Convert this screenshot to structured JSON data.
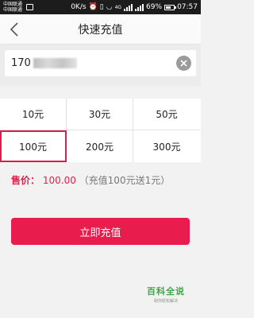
{
  "status_bar": {
    "carrier_1": "中国联通",
    "carrier_2": "中国联通",
    "speed": "0K/s",
    "network": "4G",
    "battery": "69%",
    "battery_level": 0.69,
    "time": "07:57"
  },
  "nav": {
    "title": "快速充值"
  },
  "phone": {
    "value": "170"
  },
  "amounts": [
    {
      "label": "10元",
      "selected": false
    },
    {
      "label": "30元",
      "selected": false
    },
    {
      "label": "50元",
      "selected": false
    },
    {
      "label": "100元",
      "selected": true
    },
    {
      "label": "200元",
      "selected": false
    },
    {
      "label": "300元",
      "selected": false
    }
  ],
  "price": {
    "label": "售价：",
    "value": "100.00",
    "note": "（充值100元送1元）"
  },
  "recharge_button": {
    "label": "立即充值"
  },
  "watermark": {
    "main": "百科全说",
    "sub": "助你轻松解决"
  },
  "colors": {
    "accent": "#e81c4d",
    "selected_border": "#d81e4c",
    "watermark": "#3aa844"
  }
}
